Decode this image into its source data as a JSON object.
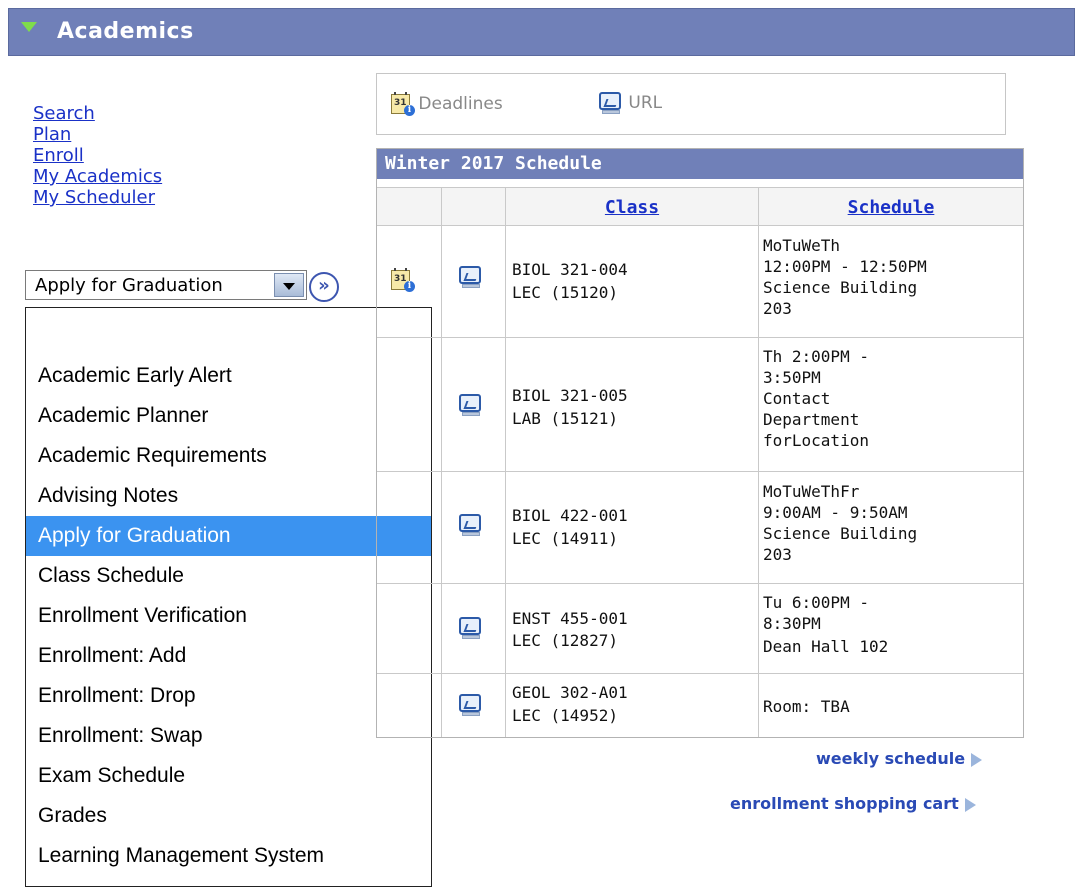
{
  "header": {
    "title": "Academics"
  },
  "nav": {
    "links": [
      "Search",
      "Plan",
      "Enroll",
      "My Academics",
      "My Scheduler"
    ]
  },
  "select": {
    "value": "Apply for Graduation",
    "go_label": "»"
  },
  "dropdown": {
    "options": [
      "",
      "Academic Early Alert",
      "Academic Planner",
      "Academic Requirements",
      "Advising Notes",
      "Apply for Graduation",
      "Class Schedule",
      "Enrollment Verification",
      "Enrollment: Add",
      "Enrollment: Drop",
      "Enrollment: Swap",
      "Exam Schedule",
      "Grades",
      "Learning Management System"
    ],
    "selected": "Apply for Graduation"
  },
  "toolbar": {
    "deadlines_label": "Deadlines",
    "url_label": "URL",
    "deadlines_icon": "calendar-info-icon",
    "url_icon": "computer-monitor-icon"
  },
  "schedule": {
    "title": "Winter 2017 Schedule",
    "columns": {
      "class": "Class",
      "schedule": "Schedule"
    },
    "rows": [
      {
        "class_line1": "BIOL 321-004",
        "class_line2": "LEC (15120)",
        "schedule_lines": [
          "MoTuWeTh",
          "12:00PM - 12:50PM",
          "Science Building",
          "203"
        ],
        "has_deadline_icon": true
      },
      {
        "class_line1": "BIOL 321-005",
        "class_line2": "LAB (15121)",
        "schedule_lines": [
          "Th 2:00PM -",
          "3:50PM",
          "Contact",
          "Department",
          "forLocation"
        ],
        "has_deadline_icon": false
      },
      {
        "class_line1": "BIOL 422-001",
        "class_line2": "LEC (14911)",
        "schedule_lines": [
          "MoTuWeThFr",
          "9:00AM - 9:50AM",
          "Science Building",
          "203"
        ],
        "has_deadline_icon": false
      },
      {
        "class_line1": "ENST 455-001",
        "class_line2": "LEC (12827)",
        "schedule_lines": [
          "Tu 6:00PM -",
          "8:30PM",
          "Dean Hall 102"
        ],
        "has_deadline_icon": false
      },
      {
        "class_line1": "GEOL 302-A01",
        "class_line2": "LEC (14952)",
        "schedule_lines": [
          "Room:  TBA"
        ],
        "has_deadline_icon": false
      }
    ]
  },
  "links": {
    "weekly_schedule": "weekly schedule",
    "shopping_cart": "enrollment shopping cart"
  },
  "colors": {
    "header_bg": "#7080b8",
    "link": "#1a31c7",
    "selected_option": "#3b93f0"
  }
}
